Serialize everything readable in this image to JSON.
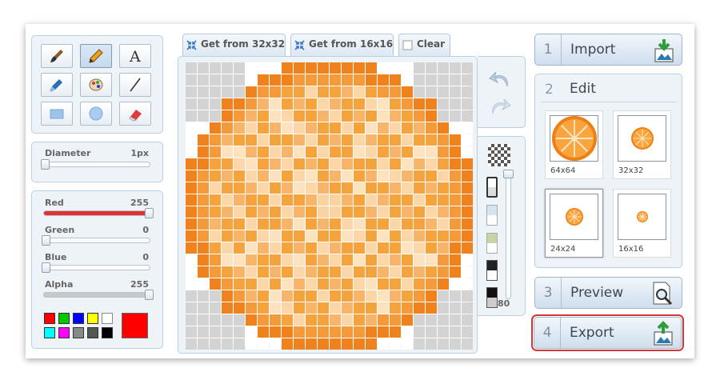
{
  "tools": [
    {
      "name": "brush-icon"
    },
    {
      "name": "pencil-icon"
    },
    {
      "name": "text-icon",
      "label": "A"
    },
    {
      "name": "eyedropper-icon"
    },
    {
      "name": "fill-icon"
    },
    {
      "name": "line-icon"
    },
    {
      "name": "rectangle-icon"
    },
    {
      "name": "ellipse-icon"
    },
    {
      "name": "eraser-icon"
    }
  ],
  "diameter": {
    "label": "Diameter",
    "value": "1px"
  },
  "sliders": [
    {
      "label": "Red",
      "value": "255",
      "fraction": 1.0,
      "color": "#e33131"
    },
    {
      "label": "Green",
      "value": "0",
      "fraction": 0,
      "color": "#fbfbfb"
    },
    {
      "label": "Blue",
      "value": "0",
      "fraction": 0,
      "color": "#fbfbfb"
    },
    {
      "label": "Alpha",
      "value": "255",
      "fraction": 1.0,
      "color": "#c8c8c8"
    }
  ],
  "palette": [
    "#ff0000",
    "#00c800",
    "#0000ff",
    "#ffff00",
    "#ffffff",
    "#00ffff",
    "#ff00ff",
    "#888888",
    "#555555",
    "#000000"
  ],
  "current_color": "#ff0000",
  "tabs": {
    "t32": "Get from 32x32",
    "t16": "Get from 16x16",
    "clear": "Clear"
  },
  "side": {
    "opacity_value": "80"
  },
  "steps": {
    "import": {
      "num": "1",
      "label": "Import"
    },
    "edit": {
      "num": "2",
      "label": "Edit"
    },
    "preview": {
      "num": "3",
      "label": "Preview"
    },
    "export": {
      "num": "4",
      "label": "Export"
    }
  },
  "thumbs": [
    {
      "label": "64x64"
    },
    {
      "label": "32x32"
    },
    {
      "label": "24x24"
    },
    {
      "label": "16x16"
    }
  ],
  "accent": {
    "selected_outline": "#d43535",
    "panel_border": "#b9cfe4"
  }
}
